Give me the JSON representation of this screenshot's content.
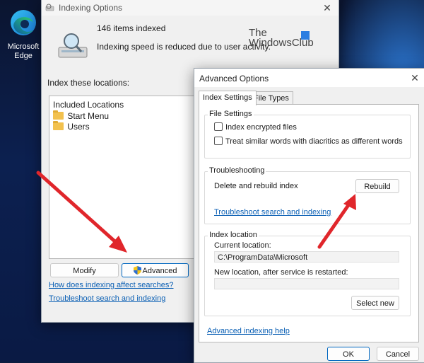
{
  "desktop": {
    "edge_icon_label": "Microsoft Edge"
  },
  "indexing_window": {
    "title": "Indexing Options",
    "items_indexed": "146 items indexed",
    "speed_message": "Indexing speed is reduced due to user activity.",
    "watermark_line1": "The",
    "watermark_line2": "WindowsClub",
    "index_these_label": "Index these locations:",
    "included_header": "Included Locations",
    "locations": [
      "Start Menu",
      "Users"
    ],
    "modify_label": "Modify",
    "advanced_label": "Advanced",
    "how_link": "How does indexing affect searches?",
    "troubleshoot_link": "Troubleshoot search and indexing"
  },
  "advanced_dialog": {
    "title": "Advanced Options",
    "tabs": [
      {
        "label": "Index Settings",
        "selected": true
      },
      {
        "label": "File Types",
        "selected": false
      }
    ],
    "file_settings": {
      "group_label": "File Settings",
      "encrypted_label": "Index encrypted files",
      "encrypted_checked": false,
      "diacritics_label": "Treat similar words with diacritics as different words",
      "diacritics_checked": false
    },
    "troubleshooting": {
      "group_label": "Troubleshooting",
      "delete_rebuild_label": "Delete and rebuild index",
      "rebuild_label": "Rebuild",
      "troubleshoot_link": "Troubleshoot search and indexing"
    },
    "index_location": {
      "group_label": "Index location",
      "current_label": "Current location:",
      "current_value": "C:\\ProgramData\\Microsoft",
      "new_label": "New location, after service is restarted:",
      "new_value": "",
      "select_new_label": "Select new"
    },
    "help_link": "Advanced indexing help",
    "ok_label": "OK",
    "cancel_label": "Cancel"
  },
  "colors": {
    "arrow": "#e0262b",
    "link": "#0a5fb4",
    "accent": "#0067c0"
  }
}
